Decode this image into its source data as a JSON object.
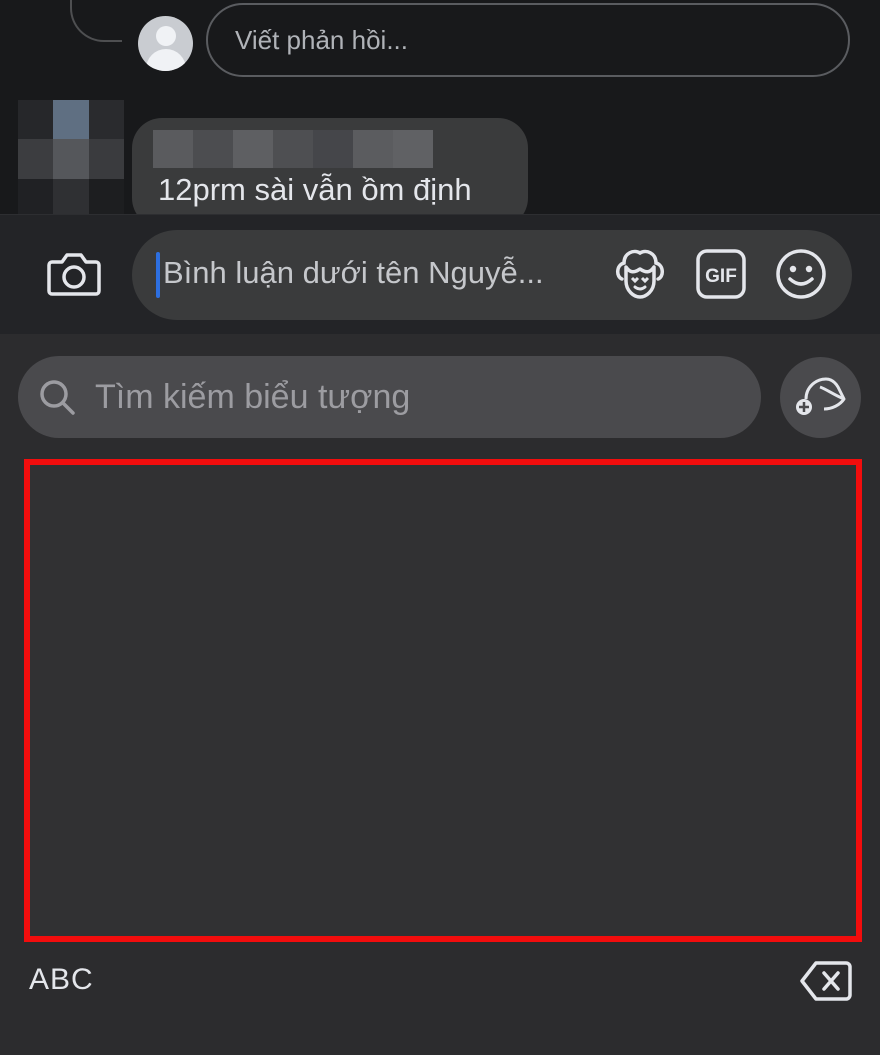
{
  "comments": {
    "reply_placeholder": "Viết phản hồi...",
    "comment": {
      "text": "12prm sài vẫn ồm định",
      "author_redacted": true
    }
  },
  "composer": {
    "placeholder": "Bình luận dưới tên Nguyễ...",
    "icons": [
      "camera-icon",
      "avatar-sticker-icon",
      "gif-icon",
      "emoji-icon"
    ]
  },
  "sticker_panel": {
    "search_placeholder": "Tìm kiếm biểu tượng",
    "keyboard_switch_label": "ABC",
    "highlight_color": "#f20d0d"
  },
  "colors": {
    "background": "#18191b",
    "bubble": "#3a3b3c",
    "panel": "#2c2c2e",
    "caret": "#2d6fe0"
  }
}
